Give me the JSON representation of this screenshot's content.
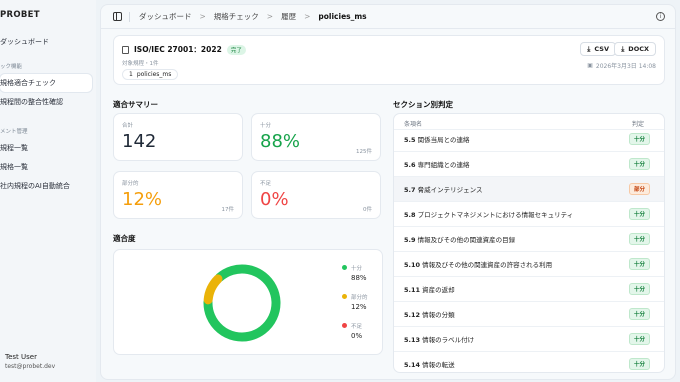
{
  "sidebar": {
    "brand": "PROBET",
    "items": [
      {
        "label": "ダッシュボード"
      },
      {
        "label": "規格適合チェック"
      },
      {
        "label": "規程間の整合性確認"
      },
      {
        "label": "規程一覧"
      },
      {
        "label": "規格一覧"
      },
      {
        "label": "社内規程のAI自動統合"
      }
    ],
    "sections": [
      "ック機能",
      "メント管理"
    ],
    "user": {
      "name": "Test User",
      "email": "test@probet.dev"
    }
  },
  "topbar": {
    "breadcrumbs": [
      "ダッシュボード",
      "規格チェック",
      "履歴",
      "policies_ms"
    ],
    "separator": ">"
  },
  "standard": {
    "title": "ISO/IEC 27001：2022",
    "status": "完了",
    "meta": "対象規程・1件",
    "chip_count": "1",
    "chip_label": "policies_ms",
    "csv_label": "CSV",
    "docx_label": "DOCX",
    "timestamp": "2026年3月3日 14:08"
  },
  "summary": {
    "title": "適合サマリー",
    "total": {
      "label": "合計",
      "value": "142"
    },
    "full": {
      "label": "十分",
      "value": "88%",
      "count": "125件"
    },
    "partial": {
      "label": "部分的",
      "value": "12%",
      "count": "17件"
    },
    "none": {
      "label": "不足",
      "value": "0%",
      "count": "0件"
    }
  },
  "compliance": {
    "title": "適合度",
    "legend": [
      {
        "label": "十分",
        "value": "88%",
        "color": "#22c55e"
      },
      {
        "label": "部分的",
        "value": "12%",
        "color": "#eab308"
      },
      {
        "label": "不足",
        "value": "0%",
        "color": "#ef4444"
      }
    ],
    "chart_data": {
      "type": "pie",
      "categories": [
        "十分",
        "部分的",
        "不足"
      ],
      "values": [
        88,
        12,
        0
      ],
      "colors": [
        "#22c55e",
        "#eab308",
        "#ef4444"
      ]
    }
  },
  "sections": {
    "title": "セクション別判定",
    "header_name": "条項名",
    "header_verdict": "判定",
    "rows": [
      {
        "id": "5.5",
        "name": "関係当局との連絡",
        "verdict": "十分",
        "kind": "ok"
      },
      {
        "id": "5.6",
        "name": "専門組織との連絡",
        "verdict": "十分",
        "kind": "ok"
      },
      {
        "id": "5.7",
        "name": "脅威インテリジェンス",
        "verdict": "部分",
        "kind": "part"
      },
      {
        "id": "5.8",
        "name": "プロジェクトマネジメントにおける情報セキュリティ",
        "verdict": "十分",
        "kind": "ok"
      },
      {
        "id": "5.9",
        "name": "情報及びその他の関連資産の目録",
        "verdict": "十分",
        "kind": "ok"
      },
      {
        "id": "5.10",
        "name": "情報及びその他の関連資産の許容される利用",
        "verdict": "十分",
        "kind": "ok"
      },
      {
        "id": "5.11",
        "name": "資産の返却",
        "verdict": "十分",
        "kind": "ok"
      },
      {
        "id": "5.12",
        "name": "情報の分類",
        "verdict": "十分",
        "kind": "ok"
      },
      {
        "id": "5.13",
        "name": "情報のラベル付け",
        "verdict": "十分",
        "kind": "ok"
      },
      {
        "id": "5.14",
        "name": "情報の転送",
        "verdict": "十分",
        "kind": "ok"
      }
    ]
  }
}
